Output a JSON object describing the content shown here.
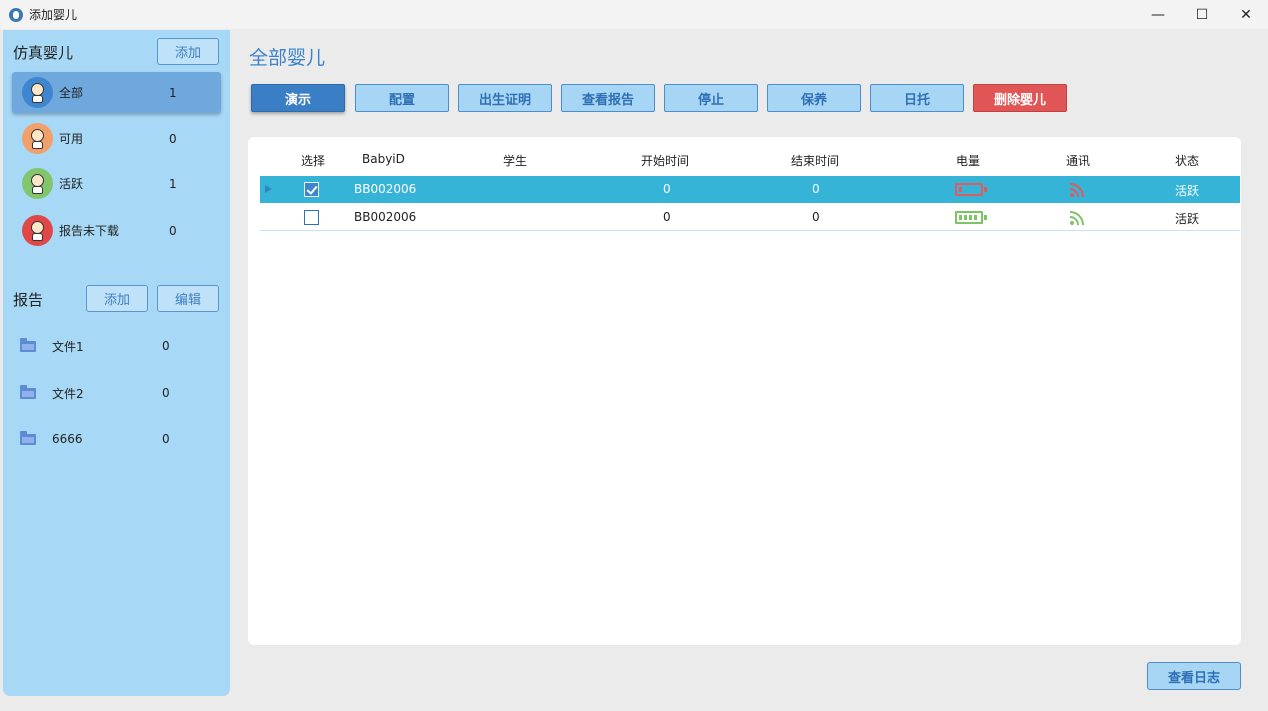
{
  "window": {
    "title": "添加婴儿",
    "controls": {
      "minimize": "—",
      "maximize": "☐",
      "close": "✕"
    }
  },
  "sidebar": {
    "babies_title": "仿真婴儿",
    "babies_add_label": "添加",
    "baby_groups": [
      {
        "label": "全部",
        "count": "1",
        "avatar_color": "#3f86d0",
        "active": true
      },
      {
        "label": "可用",
        "count": "0",
        "avatar_color": "#f2a06b",
        "active": false
      },
      {
        "label": "活跃",
        "count": "1",
        "avatar_color": "#82c56d",
        "active": false
      },
      {
        "label": "报告未下载",
        "count": "0",
        "avatar_color": "#e04848",
        "active": false
      }
    ],
    "reports_title": "报告",
    "reports_add_label": "添加",
    "reports_edit_label": "编辑",
    "reports": [
      {
        "label": "文件1",
        "count": "0"
      },
      {
        "label": "文件2",
        "count": "0"
      },
      {
        "label": "6666",
        "count": "0"
      }
    ]
  },
  "main": {
    "title": "全部婴儿",
    "toolbar": [
      {
        "label": "演示",
        "style": "primary"
      },
      {
        "label": "配置",
        "style": "normal"
      },
      {
        "label": "出生证明",
        "style": "normal"
      },
      {
        "label": "查看报告",
        "style": "normal"
      },
      {
        "label": "停止",
        "style": "normal"
      },
      {
        "label": "保养",
        "style": "normal"
      },
      {
        "label": "日托",
        "style": "normal"
      },
      {
        "label": "删除婴儿",
        "style": "danger"
      }
    ],
    "table": {
      "columns": [
        "选择",
        "BabyiD",
        "学生",
        "开始时间",
        "结束时间",
        "电量",
        "通讯",
        "状态"
      ],
      "rows": [
        {
          "checked": true,
          "baby_id": "BB002006",
          "student": "",
          "start_time": "0",
          "end_time": "0",
          "battery": "low",
          "comm": "signal-red",
          "status": "活跃",
          "selected": true
        },
        {
          "checked": false,
          "baby_id": "BB002006",
          "student": "",
          "start_time": "0",
          "end_time": "0",
          "battery": "full",
          "comm": "signal-green",
          "status": "活跃",
          "selected": false
        }
      ]
    },
    "log_button_label": "查看日志"
  },
  "colors": {
    "accent": "#3b83cc",
    "sidebar_bg": "#a7d8f5",
    "selected_row": "#35b4d8",
    "danger": "#e05555",
    "battery_low": "#e05b5b",
    "battery_full": "#7cc466"
  }
}
